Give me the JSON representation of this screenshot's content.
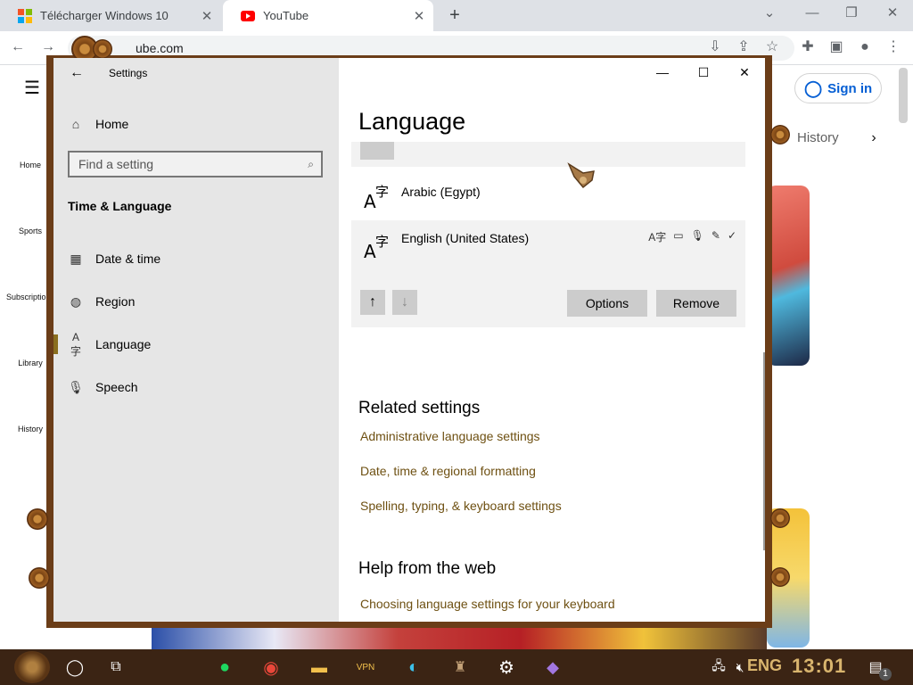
{
  "browser": {
    "tabs": [
      {
        "title": "Télécharger Windows 10",
        "icon": "windows-logo-icon"
      },
      {
        "title": "YouTube",
        "icon": "youtube-logo-icon"
      }
    ],
    "url_visible": "ube.com"
  },
  "youtube": {
    "sign_in": "Sign in",
    "history_chip": "History",
    "guide": [
      "Home",
      "Sports",
      "Subscriptions",
      "Library",
      "History"
    ]
  },
  "settings": {
    "window_title": "Settings",
    "home_label": "Home",
    "search_placeholder": "Find a setting",
    "section_title": "Time & Language",
    "nav_items": [
      "Date & time",
      "Region",
      "Language",
      "Speech"
    ],
    "page_title": "Language",
    "languages": [
      {
        "name": "Arabic (Egypt)"
      },
      {
        "name": "English (United States)"
      }
    ],
    "options_button": "Options",
    "remove_button": "Remove",
    "related_heading": "Related settings",
    "related_links": [
      "Administrative language settings",
      "Date, time & regional formatting",
      "Spelling, typing, & keyboard settings"
    ],
    "help_heading": "Help from the web",
    "help_links": [
      "Choosing language settings for your keyboard"
    ]
  },
  "taskbar": {
    "lang_indicator": "ENG",
    "clock": "13:01",
    "notification_count": "1"
  },
  "colors": {
    "link": "#6e5012",
    "accent": "#8a6e1f",
    "taskbar": "#3b2414"
  }
}
